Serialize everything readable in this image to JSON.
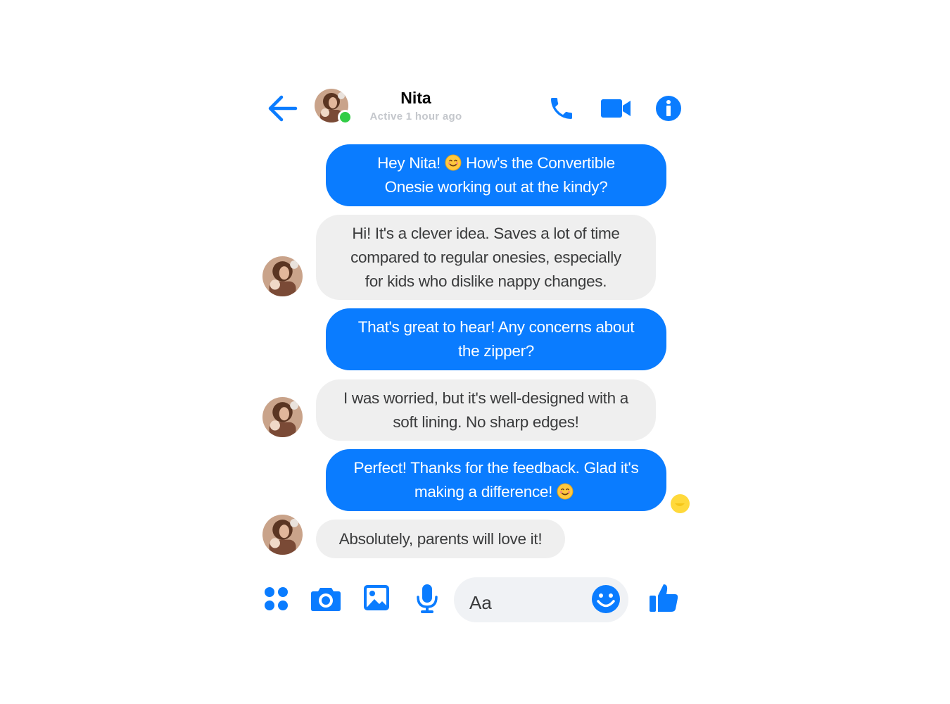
{
  "header": {
    "contact_name": "Nita",
    "status": "Active 1 hour ago",
    "icons": [
      "back-arrow-icon",
      "phone-icon",
      "video-camera-icon",
      "info-icon"
    ]
  },
  "messages": [
    {
      "direction": "outgoing",
      "line1_before_emoji": "Hey Nita!",
      "line1_after_emoji": "How's the Convertible",
      "line2": "Onesie working out at the kindy?"
    },
    {
      "direction": "incoming",
      "lines": [
        "Hi! It's a clever idea. Saves a lot of time",
        "compared to regular onesies, especially",
        "for kids who dislike nappy changes."
      ]
    },
    {
      "direction": "outgoing",
      "lines": [
        "That's great to hear! Any concerns about",
        "the zipper?"
      ]
    },
    {
      "direction": "incoming",
      "lines": [
        "I was worried, but it's well-designed with a",
        "soft lining. No sharp edges!"
      ]
    },
    {
      "direction": "outgoing",
      "line1": "Perfect! Thanks for the feedback. Glad it's",
      "line2_before_emoji": "making a difference!"
    },
    {
      "direction": "incoming",
      "lines": [
        "Absolutely, parents will love it!"
      ]
    }
  ],
  "composer": {
    "placeholder": "Aa",
    "icons": [
      "apps-icon",
      "camera-icon",
      "image-icon",
      "microphone-icon",
      "emoji-icon",
      "thumbs-up-icon"
    ]
  },
  "colors": {
    "accent": "#0a7cff",
    "incoming_bubble": "#efefef",
    "online": "#31cc46",
    "status_text": "#c4c7cc"
  }
}
